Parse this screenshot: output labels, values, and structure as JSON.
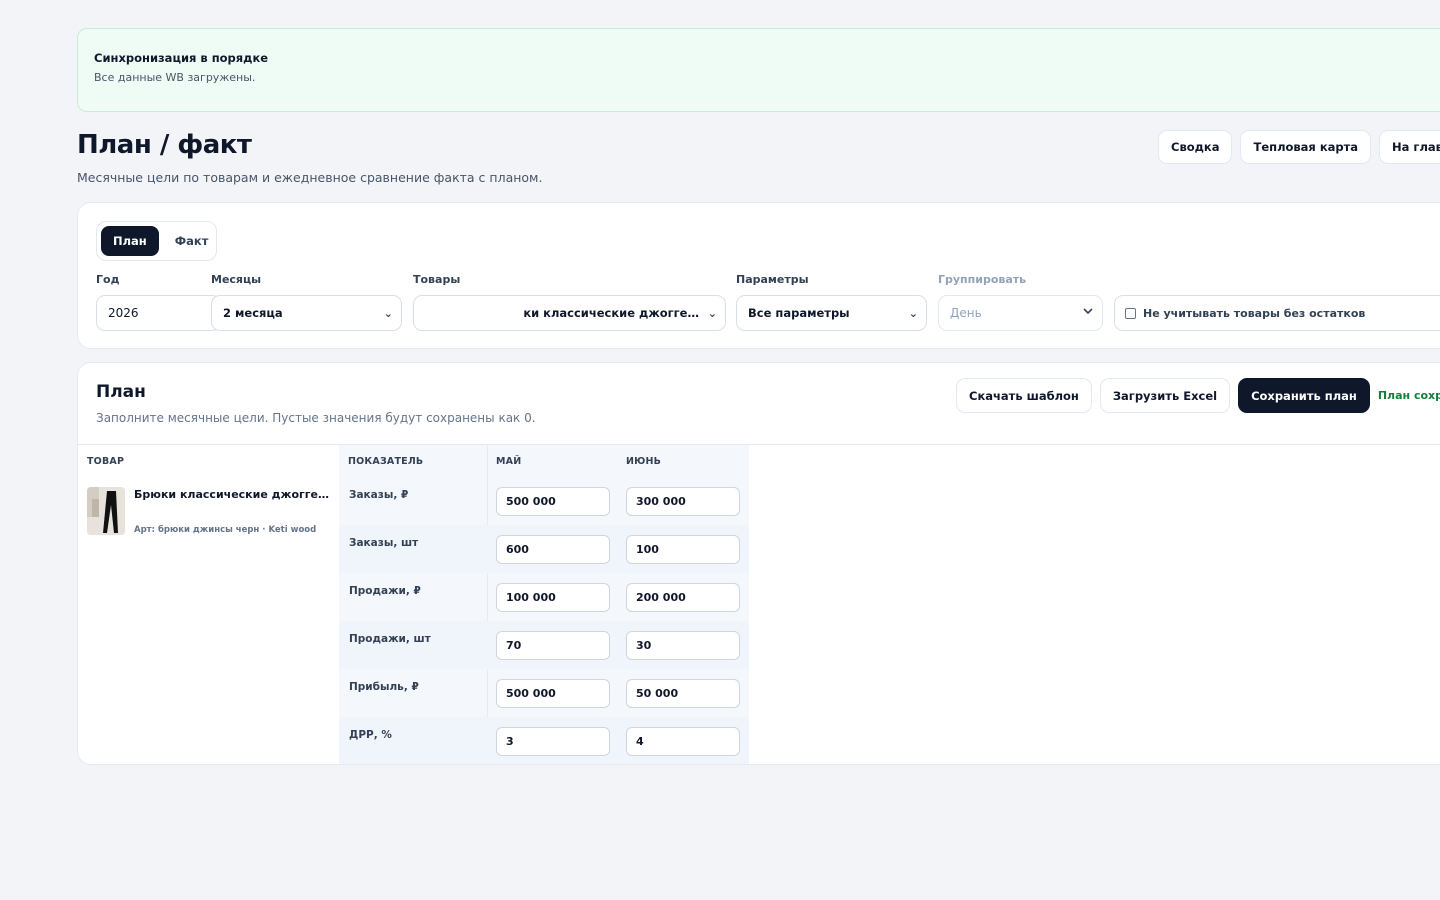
{
  "banner": {
    "title": "Синхронизация в порядке",
    "text": "Все данные WB загружены."
  },
  "header": {
    "title": "План / факт",
    "subtitle": "Месячные цели по товарам и ежедневное сравнение факта с планом.",
    "actions": [
      "Сводка",
      "Тепловая карта",
      "На главну"
    ]
  },
  "mode_toggle": {
    "plan": "План",
    "fact": "Факт",
    "active": "План"
  },
  "filters": {
    "year_label": "Год",
    "year_value": "2026",
    "months_label": "Месяцы",
    "months_value": "2 месяца",
    "products_label": "Товары",
    "products_value": "ки классические джогге…",
    "params_label": "Параметры",
    "params_value": "Все параметры",
    "group_label": "Группировать",
    "group_value": "День",
    "exclude_label": "Не учитывать товары без остатков"
  },
  "plan": {
    "title": "План",
    "subtitle": "Заполните месячные цели. Пустые значения будут сохранены как 0.",
    "download_template": "Скачать шаблон",
    "upload_excel": "Загрузить Excel",
    "save_plan": "Сохранить план",
    "saved_status": "План сохранё"
  },
  "table": {
    "columns": [
      "ТОВАР",
      "ПОКАЗАТЕЛЬ",
      "МАЙ",
      "ИЮНЬ"
    ],
    "product": {
      "name": "Брюки классические джоггеры",
      "meta": "Арт: брюки джинсы черн · Keti wood"
    },
    "rows": [
      {
        "metric": "Заказы, ₽",
        "may": "500 000",
        "jun": "300 000"
      },
      {
        "metric": "Заказы, шт",
        "may": "600",
        "jun": "100"
      },
      {
        "metric": "Продажи, ₽",
        "may": "100 000",
        "jun": "200 000"
      },
      {
        "metric": "Продажи, шт",
        "may": "70",
        "jun": "30"
      },
      {
        "metric": "Прибыль, ₽",
        "may": "500 000",
        "jun": "50 000"
      },
      {
        "metric": "ДРР, %",
        "may": "3",
        "jun": "4"
      }
    ]
  },
  "colors": {
    "background": "#f2f4f8",
    "primary_dark": "#0f172a",
    "success_bg": "#eefcf5",
    "success_text": "#15803d"
  }
}
